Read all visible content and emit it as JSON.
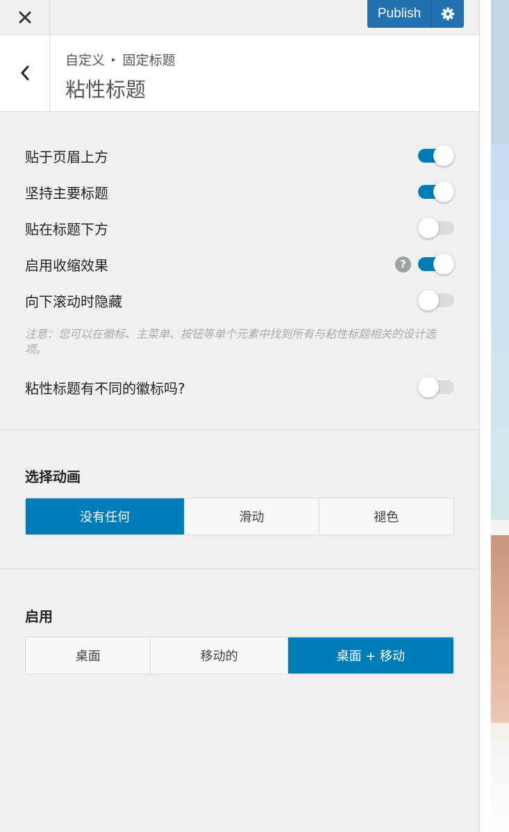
{
  "topbar": {
    "close_icon": "close-icon",
    "publish_label": "Publish",
    "settings_icon": "gear-icon",
    "accent": "#2271b1"
  },
  "header": {
    "back_icon": "chevron-left-icon",
    "breadcrumb": [
      "自定义",
      "固定标题"
    ],
    "title": "粘性标题"
  },
  "toggles": [
    {
      "label": "贴于页眉上方",
      "on": true
    },
    {
      "label": "坚持主要标题",
      "on": true
    },
    {
      "label": "贴在标题下方",
      "on": false
    },
    {
      "label": "启用收缩效果",
      "on": true,
      "help": "?"
    },
    {
      "label": "向下滚动时隐藏",
      "on": false
    }
  ],
  "note": "注意：您可以在徽标、主菜单、按钮等单个元素中找到所有与粘性标题相关的设计选项。",
  "logo_toggle": {
    "label": "粘性标题有不同的徽标吗?",
    "on": false
  },
  "animation": {
    "title": "选择动画",
    "options": [
      "没有任何",
      "滑动",
      "褪色"
    ],
    "selected": "没有任何"
  },
  "enable_on": {
    "title": "启用",
    "options": [
      "桌面",
      "移动的",
      "桌面 + 移动"
    ],
    "selected": "桌面 + 移动"
  },
  "colors": {
    "toggle_on": "#007cba",
    "toggle_off": "#dcdcde",
    "panel_bg": "#f0f0f1"
  }
}
